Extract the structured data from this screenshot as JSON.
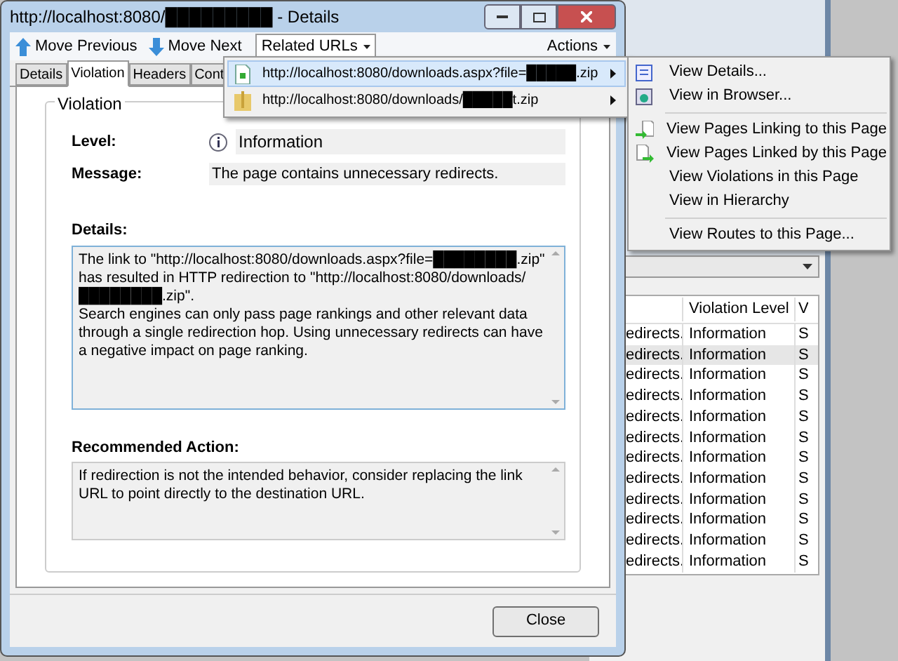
{
  "window": {
    "title": "http://localhost:8080/█████████ - Details"
  },
  "toolbar": {
    "buttons": [
      {
        "label": "Move Previous",
        "kind": "up"
      },
      {
        "label": "Move Next",
        "kind": "down"
      }
    ],
    "related_urls": {
      "label": "Related URLs",
      "expanded": true
    },
    "actions": {
      "label": "Actions"
    }
  },
  "tabs": [
    {
      "label": "Details",
      "selected": false
    },
    {
      "label": "Violation",
      "selected": true
    },
    {
      "label": "Headers",
      "selected": false
    },
    {
      "label": "Cont",
      "selected": false
    }
  ],
  "violation": {
    "group_title": "Violation",
    "level_label": "Level:",
    "level_value": "Information",
    "message_label": "Message:",
    "message_value": "The page contains unnecessary redirects.",
    "details_label": "Details:",
    "details": [
      "The link to \"http://localhost:8080/downloads.aspx?file=████████.zip\" has resulted in HTTP redirection to \"http://localhost:8080/downloads/████████.zip\".",
      "Search engines can only pass page rankings and other relevant data through a single redirection hop. Using unnecessary redirects can have a negative impact on page ranking."
    ],
    "recommended_label": "Recommended Action:",
    "recommended": "If redirection is not the intended behavior, consider replacing the link URL to point directly to the destination URL."
  },
  "close_button": "Close",
  "related_menu": [
    {
      "label": "http://localhost:8080/downloads.aspx?file=█████.zip",
      "kind": "page",
      "selected": true
    },
    {
      "label": "http://localhost:8080/downloads/█████t.zip",
      "kind": "file",
      "selected": false
    }
  ],
  "submenu": [
    {
      "label": "View Details...",
      "kind": "details"
    },
    {
      "label": "View in Browser...",
      "kind": "browser"
    },
    {
      "kind": "separator"
    },
    {
      "label": "View Pages Linking to this Page",
      "kind": "linking"
    },
    {
      "label": "View Pages Linked by this Page",
      "kind": "linked"
    },
    {
      "label": "View Violations in this Page",
      "kind": "none"
    },
    {
      "label": "View in Hierarchy",
      "kind": "none"
    },
    {
      "kind": "separator"
    },
    {
      "label": "View Routes to this Page...",
      "kind": "none"
    }
  ],
  "background_table": {
    "columns": [
      "",
      "Violation Level",
      "V"
    ],
    "rows": [
      {
        "cells": [
          "edirects.",
          "Information",
          "S"
        ],
        "selected": false
      },
      {
        "cells": [
          "edirects.",
          "Information",
          "S"
        ],
        "selected": true
      },
      {
        "cells": [
          "edirects.",
          "Information",
          "S"
        ],
        "selected": false
      },
      {
        "cells": [
          "edirects.",
          "Information",
          "S"
        ],
        "selected": false
      },
      {
        "cells": [
          "edirects.",
          "Information",
          "S"
        ],
        "selected": false
      },
      {
        "cells": [
          "edirects.",
          "Information",
          "S"
        ],
        "selected": false
      },
      {
        "cells": [
          "edirects.",
          "Information",
          "S"
        ],
        "selected": false
      },
      {
        "cells": [
          "edirects.",
          "Information",
          "S"
        ],
        "selected": false
      },
      {
        "cells": [
          "edirects.",
          "Information",
          "S"
        ],
        "selected": false
      },
      {
        "cells": [
          "edirects.",
          "Information",
          "S"
        ],
        "selected": false
      },
      {
        "cells": [
          "edirects.",
          "Information",
          "S"
        ],
        "selected": false
      },
      {
        "cells": [
          "edirects.",
          "Information",
          "S"
        ],
        "selected": false
      }
    ]
  }
}
